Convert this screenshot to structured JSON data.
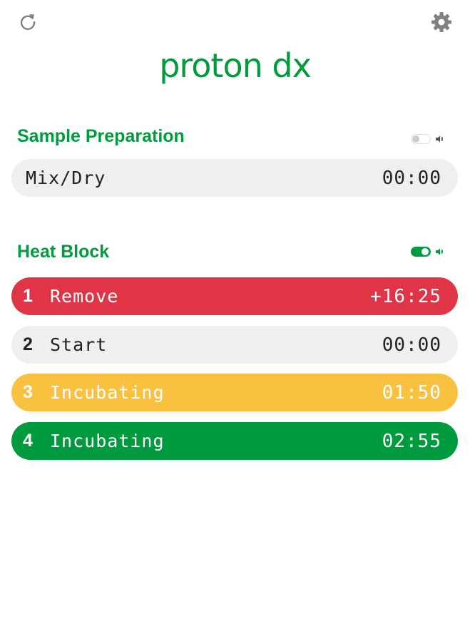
{
  "colors": {
    "brand_green": "#009b3e",
    "alert_red": "#df3546",
    "warning_yellow": "#f8c140",
    "neutral_grey": "#efefef",
    "icon_grey": "#808080"
  },
  "header": {
    "refresh_icon": "refresh-icon",
    "settings_icon": "gear-icon",
    "logo_text": "proton dx"
  },
  "sample_preparation": {
    "title": "Sample Preparation",
    "sound_enabled": false,
    "sound_icon": "speaker-icon",
    "row": {
      "label": "Mix/Dry",
      "time": "00:00",
      "status_color": "#efefef"
    }
  },
  "heat_block": {
    "title": "Heat Block",
    "sound_enabled": true,
    "sound_icon": "speaker-icon",
    "rows": [
      {
        "number": "1",
        "label": "Remove",
        "time": "+16:25",
        "status": "red"
      },
      {
        "number": "2",
        "label": "Start",
        "time": "00:00",
        "status": "grey"
      },
      {
        "number": "3",
        "label": "Incubating",
        "time": "01:50",
        "status": "yellow"
      },
      {
        "number": "4",
        "label": "Incubating",
        "time": "02:55",
        "status": "green"
      }
    ]
  }
}
